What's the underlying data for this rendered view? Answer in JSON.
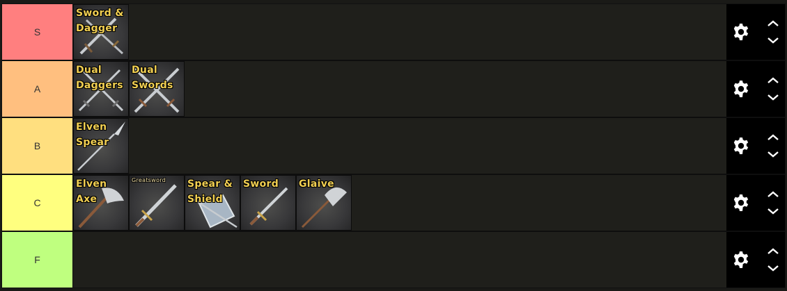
{
  "colors": {
    "tier_S": "#ff7f7f",
    "tier_A": "#ffbf7f",
    "tier_B": "#ffdf7f",
    "tier_C": "#ffff7f",
    "tier_F": "#bfff7f",
    "item_text": "#f1cf52",
    "panel_bg": "#1f1f1b",
    "controls_bg": "#000000"
  },
  "tiers": [
    {
      "label": "S",
      "items": [
        {
          "name": "Sword & Dagger",
          "icon": "sword-and-dagger-icon"
        }
      ]
    },
    {
      "label": "A",
      "items": [
        {
          "name": "Dual Daggers",
          "icon": "dual-daggers-icon"
        },
        {
          "name": "Dual Swords",
          "icon": "dual-swords-icon"
        }
      ]
    },
    {
      "label": "B",
      "items": [
        {
          "name": "Elven Spear",
          "icon": "elven-spear-icon"
        }
      ]
    },
    {
      "label": "C",
      "items": [
        {
          "name": "Elven Axe",
          "icon": "elven-axe-icon"
        },
        {
          "name": "Greatsword",
          "icon": "greatsword-icon"
        },
        {
          "name": "Spear & Shield",
          "icon": "spear-and-shield-icon"
        },
        {
          "name": "Sword",
          "icon": "sword-icon"
        },
        {
          "name": "Glaive",
          "icon": "glaive-icon"
        }
      ]
    },
    {
      "label": "F",
      "items": []
    }
  ],
  "controls": {
    "settings_icon": "gear-icon",
    "move_up_icon": "chevron-up-icon",
    "move_down_icon": "chevron-down-icon"
  }
}
